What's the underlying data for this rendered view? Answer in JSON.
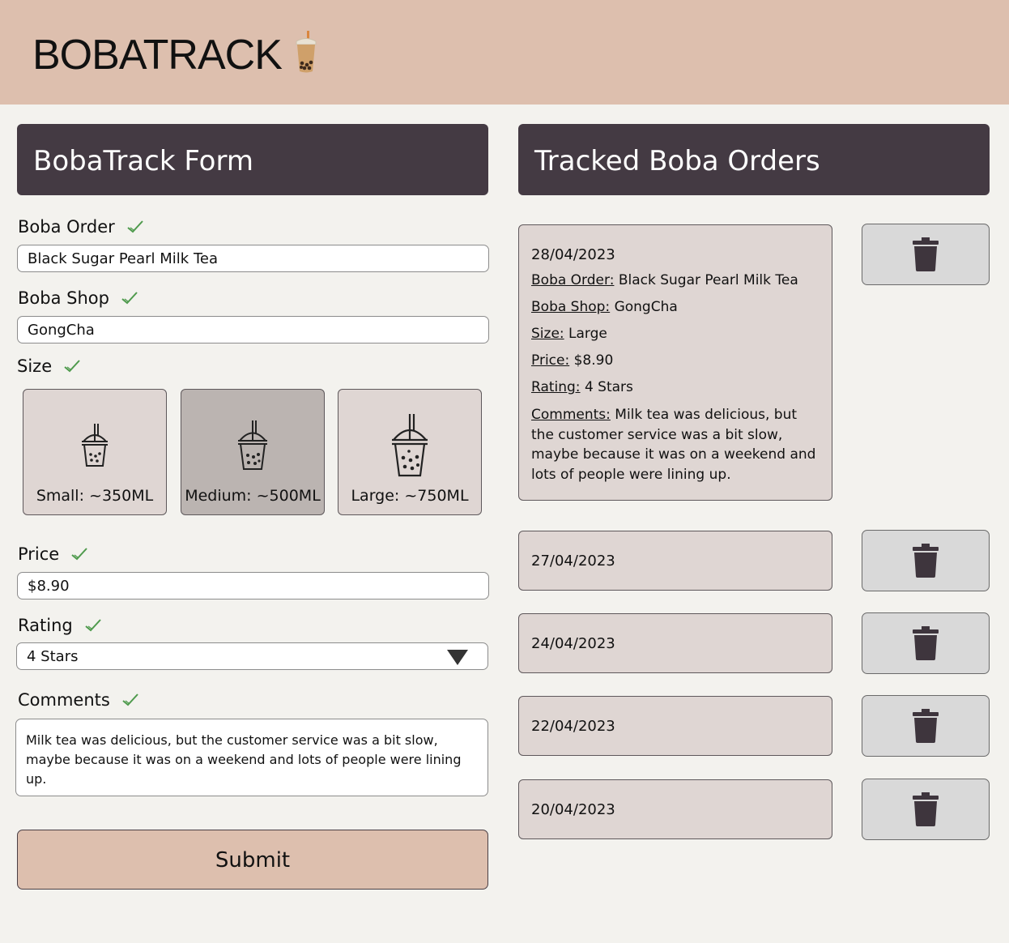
{
  "header": {
    "title": "BOBATRACK"
  },
  "form": {
    "title": "BobaTrack Form",
    "order_label": "Boba Order",
    "order_value": "Black Sugar Pearl Milk Tea",
    "shop_label": "Boba Shop",
    "shop_value": "GongCha",
    "size_label": "Size",
    "sizes": [
      {
        "label": "Small: ~350ML",
        "selected": false
      },
      {
        "label": "Medium: ~500ML",
        "selected": true
      },
      {
        "label": "Large: ~750ML",
        "selected": false
      }
    ],
    "price_label": "Price",
    "price_value": "$8.90",
    "rating_label": "Rating",
    "rating_value": "4 Stars",
    "comments_label": "Comments",
    "comments_value": "Milk tea was delicious, but the customer service was a bit slow, maybe because it was on a weekend and lots of people were lining up.",
    "submit_label": "Submit"
  },
  "orders": {
    "title": "Tracked Boba Orders",
    "expanded": {
      "date": "28/04/2023",
      "order_label": "Boba Order:",
      "order_value": "Black Sugar Pearl Milk Tea",
      "shop_label": "Boba Shop:",
      "shop_value": "GongCha",
      "size_label": "Size:",
      "size_value": "Large",
      "price_label": "Price:",
      "price_value": "$8.90",
      "rating_label": "Rating:",
      "rating_value": "4 Stars",
      "comments_label": "Comments:",
      "comments_value": "Milk tea was delicious, but the customer service was a bit slow, maybe because it was on a weekend and lots of people were lining up."
    },
    "collapsed": [
      {
        "date": "27/04/2023"
      },
      {
        "date": "24/04/2023"
      },
      {
        "date": "22/04/2023"
      },
      {
        "date": "20/04/2023"
      }
    ]
  },
  "colors": {
    "header_bg": "#ddbfae",
    "panel_title_bg": "#443a43",
    "card_bg": "#dfd6d3",
    "selected_card_bg": "#bbb4b1",
    "check_green": "#4e9a4c",
    "page_bg": "#f3f2ee"
  },
  "icons": {
    "logo": "bubble-tea-icon",
    "check": "checkmark-icon",
    "size_cup": "boba-cup-icon",
    "delete": "trash-icon",
    "dropdown": "triangle-down-icon"
  }
}
